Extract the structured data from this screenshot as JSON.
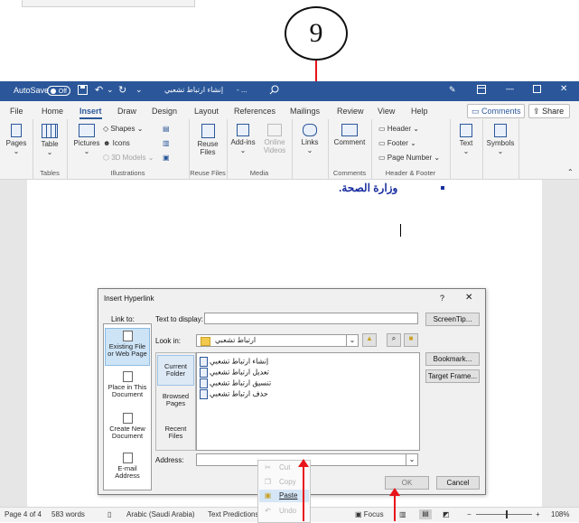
{
  "step_number": "9",
  "titlebar": {
    "autosave_label": "AutoSave",
    "autosave_state": "Off",
    "document_title": "إنشاء ارتباط تشعبي",
    "title_suffix": "- ..."
  },
  "tabs": [
    "File",
    "Home",
    "Insert",
    "Draw",
    "Design",
    "Layout",
    "References",
    "Mailings",
    "Review",
    "View",
    "Help"
  ],
  "active_tab": "Insert",
  "comments_label": "Comments",
  "share_label": "Share",
  "ribbon": {
    "pages": "Pages",
    "table": "Table",
    "tables_group": "Tables",
    "pictures": "Pictures",
    "shapes": "Shapes",
    "icons": "Icons",
    "models_3d": "3D Models",
    "illustrations_group": "Illustrations",
    "reuse_files": "Reuse Files",
    "reuse_files_group": "Reuse Files",
    "addins": "Add-ins",
    "online_videos": "Online Videos",
    "media_group": "Media",
    "links": "Links",
    "comment": "Comment",
    "comments_group": "Comments",
    "header": "Header",
    "footer": "Footer",
    "page_number": "Page Number",
    "header_footer_group": "Header & Footer",
    "text": "Text",
    "symbols": "Symbols"
  },
  "document": {
    "bullet_text": "وزارة الصحة."
  },
  "dialog": {
    "title": "Insert Hyperlink",
    "help": "?",
    "close": "✕",
    "link_to": "Link to:",
    "text_to_display_label": "Text to display:",
    "text_to_display_value": "",
    "screentip": "ScreenTip...",
    "look_in_label": "Look in:",
    "look_in_value": "ارتباط تشعبي",
    "link_types": [
      {
        "label": "Existing File or Web Page",
        "selected": true
      },
      {
        "label": "Place in This Document",
        "selected": false
      },
      {
        "label": "Create New Document",
        "selected": false
      },
      {
        "label": "E-mail Address",
        "selected": false
      }
    ],
    "nav_items": [
      {
        "label": "Current Folder",
        "selected": true
      },
      {
        "label": "Browsed Pages",
        "selected": false
      },
      {
        "label": "Recent Files",
        "selected": false
      }
    ],
    "files": [
      "إنشاء ارتباط تشعبي",
      "تعديل ارتباط تشعبي",
      "تنسيق ارتباط تشعبي",
      "حذف ارتباط تشعبي"
    ],
    "bookmark": "Bookmark...",
    "target_frame": "Target Frame...",
    "address_label": "Address:",
    "address_value": "",
    "ok": "OK",
    "cancel": "Cancel"
  },
  "context_menu": [
    {
      "label": "Cut",
      "icon": "scissors-icon",
      "enabled": false
    },
    {
      "label": "Copy",
      "icon": "copy-icon",
      "enabled": false
    },
    {
      "label": "Paste",
      "icon": "paste-icon",
      "enabled": true
    },
    {
      "label": "Undo",
      "icon": "undo-icon",
      "enabled": false
    }
  ],
  "statusbar": {
    "page": "Page 4 of 4",
    "words": "583 words",
    "language": "Arabic (Saudi Arabia)",
    "text_predictions": "Text Predictions:",
    "focus": "Focus",
    "zoom": "108%"
  },
  "colors": {
    "word_blue": "#2b579a",
    "arrow_red": "#e8141b",
    "arabic_text": "#1a2ea0"
  }
}
